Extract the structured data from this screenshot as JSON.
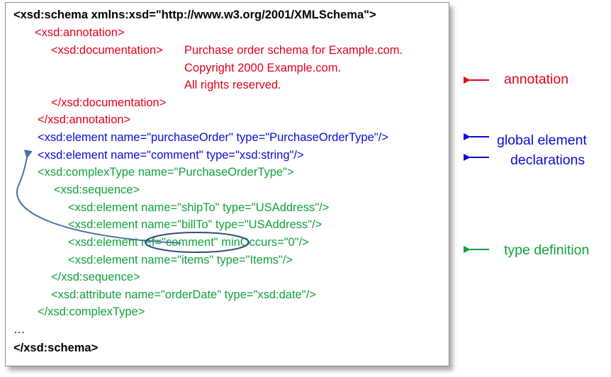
{
  "code": {
    "schema_open": "<xsd:schema xmlns:xsd=\"http://www.w3.org/2001/XMLSchema\">",
    "annotation_open": "<xsd:annotation>",
    "documentation_open": "<xsd:documentation>",
    "doc_line1": "Purchase order schema for Example.com.",
    "doc_line2": "Copyright 2000 Example.com.",
    "doc_line3": "All rights reserved.",
    "documentation_close": "</xsd:documentation>",
    "annotation_close": "</xsd:annotation>",
    "element_purchase_order": "<xsd:element name=\"purchaseOrder\" type=\"PurchaseOrderType\"/>",
    "element_comment": "<xsd:element name=\"comment\" type=\"xsd:string\"/>",
    "complex_type_open": "<xsd:complexType name=\"PurchaseOrderType\">",
    "sequence_open": "<xsd:sequence>",
    "element_ship_to": "<xsd:element name=\"shipTo\" type=\"USAddress\"/>",
    "element_bill_to": "<xsd:element name=\"billTo\" type=\"USAddress\"/>",
    "element_ref_comment": "<xsd:element ref=\"comment\" minOccurs=\"0\"/>",
    "element_items": "<xsd:element name=\"items\" type=\"Items\"/>",
    "sequence_close": "</xsd:sequence>",
    "attribute_order_date": "<xsd:attribute name=\"orderDate\" type=\"xsd:date\"/>",
    "complex_type_close": "</xsd:complexType>",
    "ellipsis": "…",
    "schema_close": "</xsd:schema>"
  },
  "annotations": {
    "annotation_label": "annotation",
    "global_label_line1": "global element",
    "global_label_line2": "declarations",
    "type_definition_label": "type definition"
  },
  "colors": {
    "annotation": "#e3001b",
    "global": "#0a0ad6",
    "type_definition": "#11a03b",
    "ref_arrow": "#4a6fa5"
  }
}
